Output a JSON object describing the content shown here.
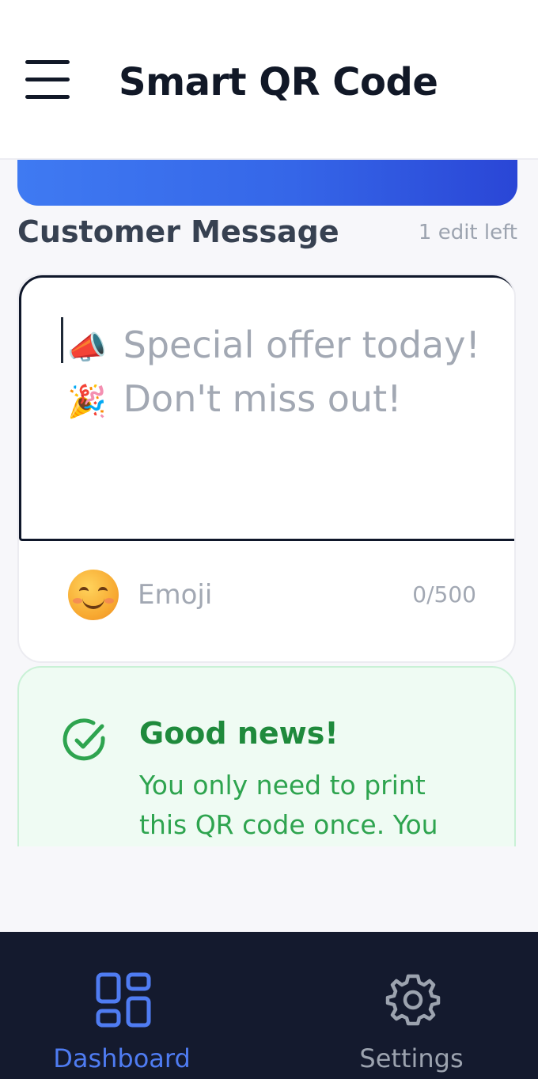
{
  "header": {
    "title": "Smart QR Code",
    "menu_icon": "hamburger-menu-icon"
  },
  "section": {
    "title": "Customer Message",
    "edits_left": "1 edit left"
  },
  "message": {
    "placeholder_line_1_emoji": "📣",
    "placeholder_line_1": "Special offer today!",
    "placeholder_line_2_emoji": "🎉",
    "placeholder_line_2": "Don't miss out!",
    "value": "",
    "emoji_label": "Emoji",
    "emoji_icon": "smiling-face-icon",
    "char_count": "0/500"
  },
  "info": {
    "icon": "check-circle-icon",
    "title": "Good news!",
    "text": "You only need to print this QR code once. You"
  },
  "nav": {
    "items": [
      {
        "label": "Dashboard",
        "icon": "dashboard-grid-icon",
        "active": true
      },
      {
        "label": "Settings",
        "icon": "gear-icon",
        "active": false
      }
    ]
  },
  "colors": {
    "accent": "#4f7cf2",
    "success": "#2ea44f",
    "nav_background": "#141a2e"
  }
}
